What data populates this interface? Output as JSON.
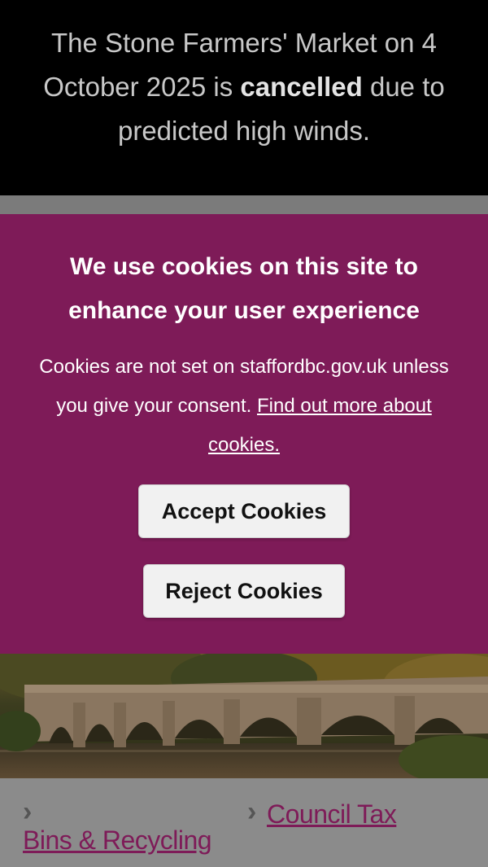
{
  "alert": {
    "text_before": "The Stone Farmers' Market on 4 October 2025 is ",
    "text_bold": "cancelled",
    "text_after": " due to predicted high winds."
  },
  "cookie_banner": {
    "heading": "We use cookies on this site to enhance your user experience",
    "body": "Cookies are not set on staffordbc.gov.uk unless you give your consent. ",
    "link": "Find out more about cookies.",
    "accept_label": "Accept Cookies",
    "reject_label": "Reject Cookies"
  },
  "quick_links": [
    {
      "label": "Bins & Recycling"
    },
    {
      "label": "Council Tax"
    }
  ],
  "colors": {
    "brand": "#7e1b58",
    "alert_bg": "#000000"
  },
  "icons": [
    "chevron-right-icon"
  ]
}
